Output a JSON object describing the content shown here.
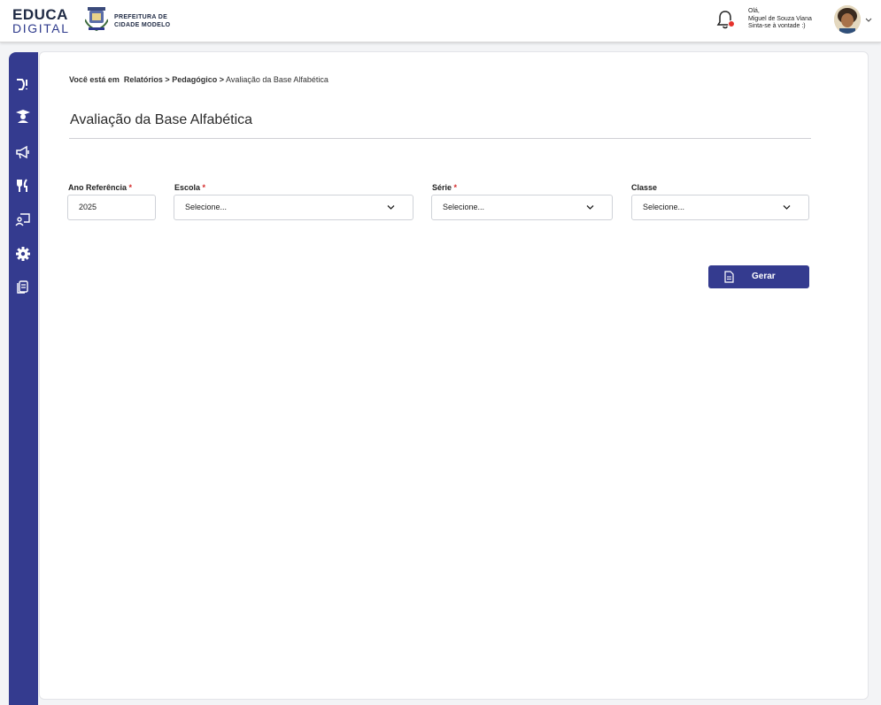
{
  "header": {
    "logo_line1": "EDUCA",
    "logo_line2": "DIGITAL",
    "prefeitura_line1": "PREFEITURA DE",
    "prefeitura_line2": "CIDADE MODELO",
    "notification_count": "",
    "greeting_line1": "Olá,",
    "greeting_line2": "Miguel de Souza Viana",
    "greeting_line3": "Sinta-se à vontade :)"
  },
  "sidebar": {
    "icons": [
      "alphabet-icon",
      "graduate-icon",
      "megaphone-icon",
      "utensils-icon",
      "teacher-board-icon",
      "gear-icon",
      "documents-icon"
    ]
  },
  "breadcrumb": {
    "prefix": "Você está em",
    "level1": "Relatórios",
    "sep1": ">",
    "level2": "Pedagógico",
    "sep2": ">",
    "current": "Avaliação da Base Alfabética"
  },
  "page": {
    "title": "Avaliação da Base Alfabética"
  },
  "form": {
    "ano": {
      "label": "Ano Referência",
      "required": "*",
      "value": "2025"
    },
    "escola": {
      "label": "Escola",
      "required": "*",
      "value": "Selecione..."
    },
    "serie": {
      "label": "Série",
      "required": "*",
      "value": "Selecione..."
    },
    "classe": {
      "label": "Classe",
      "value": "Selecione..."
    }
  },
  "actions": {
    "gerar_label": "Gerar"
  },
  "colors": {
    "primary": "#343b8f",
    "required": "#d42a2a",
    "badge": "#e5312b"
  }
}
